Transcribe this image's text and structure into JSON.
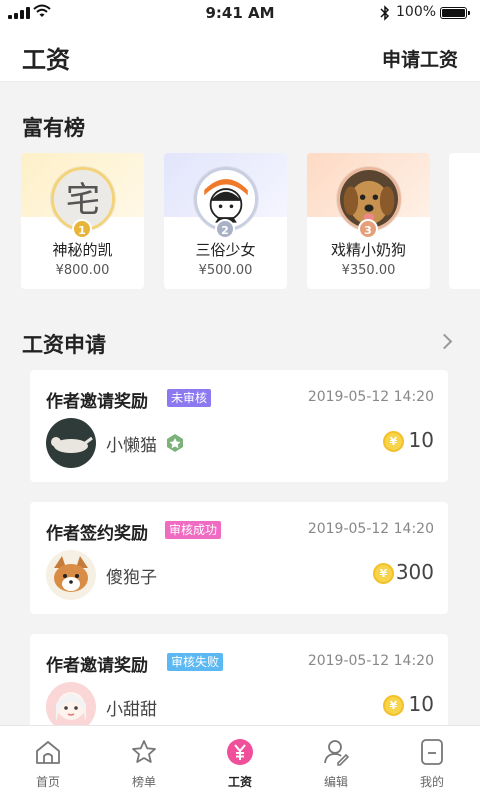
{
  "status_bar": {
    "time": "9:41 AM",
    "battery": "100%"
  },
  "header": {
    "title": "工资",
    "action": "申请工资"
  },
  "rich_list": {
    "title": "富有榜",
    "items": [
      {
        "rank": "1",
        "name": "神秘的凯",
        "amount": "¥800.00",
        "bg_color": "#fdf0c8",
        "badge_color": "#e8b53a"
      },
      {
        "rank": "2",
        "name": "三俗少女",
        "amount": "¥500.00",
        "bg_color": "#e7e9fb",
        "badge_color": "#a9b1c6"
      },
      {
        "rank": "3",
        "name": "戏精小奶狗",
        "amount": "¥350.00",
        "bg_color": "#fde3d2",
        "badge_color": "#e5a07b"
      }
    ]
  },
  "requests": {
    "title": "工资申请",
    "items": [
      {
        "title": "作者邀请奖励",
        "status": "未审核",
        "status_color": "#8c79f0",
        "time": "2019-05-12  14:20",
        "user": "小懒猫",
        "amount": "10"
      },
      {
        "title": "作者签约奖励",
        "status": "审核成功",
        "status_color": "#f06cc2",
        "time": "2019-05-12  14:20",
        "user": "傻狍子",
        "amount": "300"
      },
      {
        "title": "作者邀请奖励",
        "status": "审核失败",
        "status_color": "#5cb8f2",
        "time": "2019-05-12  14:20",
        "user": "小甜甜",
        "amount": "10"
      }
    ]
  },
  "tabbar": {
    "tabs": [
      {
        "label": "首页",
        "icon": "home-icon"
      },
      {
        "label": "榜单",
        "icon": "star-icon"
      },
      {
        "label": "工资",
        "icon": "yen-icon",
        "active": true
      },
      {
        "label": "编辑",
        "icon": "edit-user-icon"
      },
      {
        "label": "我的",
        "icon": "profile-icon"
      }
    ]
  }
}
